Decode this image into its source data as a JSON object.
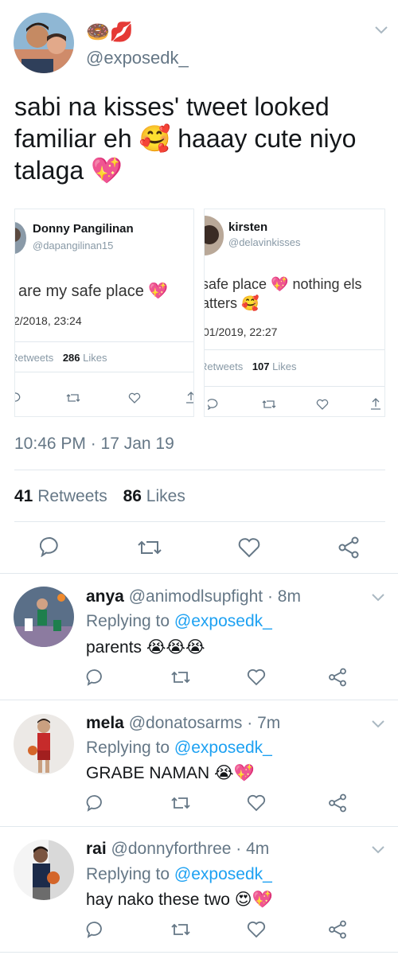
{
  "tweet": {
    "name_emoji": "🍩💋",
    "handle": "@exposedk_",
    "text_line1": "sabi na kisses' tweet looked",
    "text_line2": "familiar eh 🥰 haaay cute niyo",
    "text_line3": "talaga 💖",
    "timestamp": "10:46 PM · 17 Jan 19",
    "retweets_count": "41",
    "retweets_label": "Retweets",
    "likes_count": "86",
    "likes_label": "Likes"
  },
  "embedded": [
    {
      "name": "Donny Pangilinan",
      "handle": "@dapangilinan15",
      "text": "are my safe place 💖",
      "date": "2/2018, 23:24",
      "retweets_label": "Retweets",
      "likes_count": "286",
      "likes_label": "Likes"
    },
    {
      "name": "kirsten",
      "handle": "@delavinkisses",
      "text_line1": "safe place 💖 nothing els",
      "text_line2": "atters 🥰",
      "date": "01/2019, 22:27",
      "retweets_label": "Retweets",
      "likes_count": "107",
      "likes_label": "Likes"
    }
  ],
  "replies": [
    {
      "name": "anya",
      "handle": "@animodlsupfight",
      "time": "· 8m",
      "replying_prefix": "Replying to",
      "replying_to": "@exposedk_",
      "text": "parents 😭😭😭"
    },
    {
      "name": "mela",
      "handle": "@donatosarms",
      "time": "· 7m",
      "replying_prefix": "Replying to",
      "replying_to": "@exposedk_",
      "text": "GRABE NAMAN 😭💖"
    },
    {
      "name": "rai",
      "handle": "@donnyforthree",
      "time": "· 4m",
      "replying_prefix": "Replying to",
      "replying_to": "@exposedk_",
      "text": "hay nako these two 😍💖"
    }
  ],
  "colors": {
    "link": "#1da1f2",
    "muted": "#657786",
    "icon": "#657786"
  }
}
